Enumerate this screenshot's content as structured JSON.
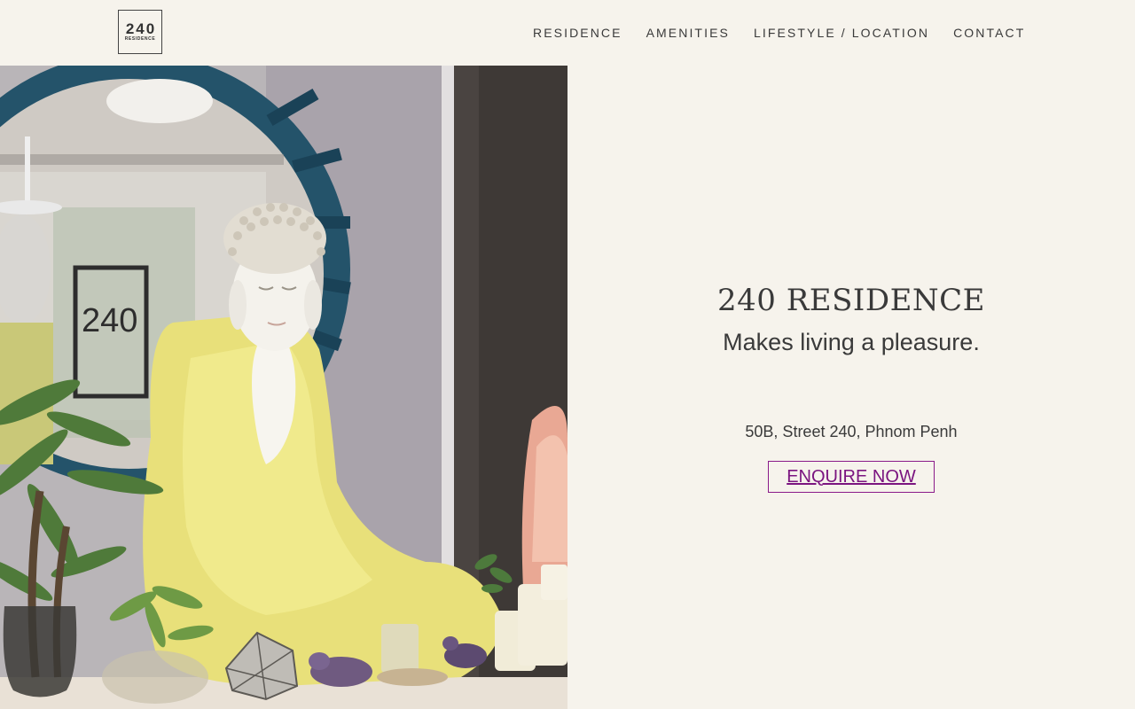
{
  "logo": {
    "number": "240",
    "subtitle": "RESIDENCE"
  },
  "nav": [
    {
      "label": "RESIDENCE"
    },
    {
      "label": "AMENITIES"
    },
    {
      "label": "LIFESTYLE / LOCATION"
    },
    {
      "label": "CONTACT"
    }
  ],
  "hero": {
    "title": "240 RESIDENCE",
    "tagline": "Makes living a pleasure.",
    "address": "50B, Street 240, Phnom Penh",
    "cta_label": "ENQUIRE NOW"
  },
  "colors": {
    "background": "#f6f3ec",
    "text": "#3a3a3a",
    "cta": "#7b1580"
  }
}
